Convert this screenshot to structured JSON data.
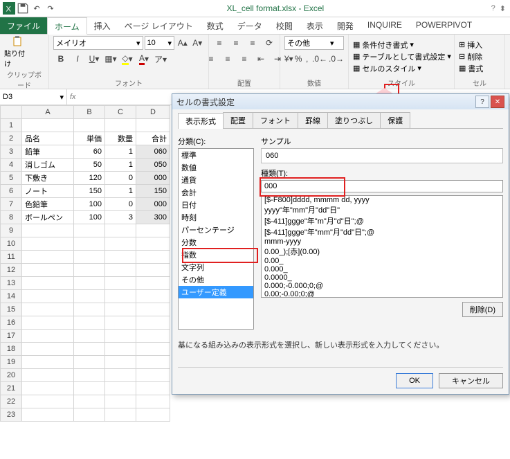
{
  "title": "XL_cell format.xlsx - Excel",
  "tabs": {
    "file": "ファイル",
    "home": "ホーム",
    "insert": "挿入",
    "layout": "ページ レイアウト",
    "formula": "数式",
    "data": "データ",
    "review": "校閲",
    "view": "表示",
    "dev": "開発",
    "inquire": "INQUIRE",
    "pp": "POWERPIVOT"
  },
  "ribbon": {
    "clipboard": {
      "paste": "貼り付け",
      "label": "クリップボード"
    },
    "font": {
      "name": "メイリオ",
      "size": "10",
      "label": "フォント"
    },
    "align": {
      "label": "配置"
    },
    "number": {
      "fmt": "その他",
      "label": "数値"
    },
    "styles": {
      "cond": "条件付き書式",
      "tbl": "テーブルとして書式設定",
      "cell": "セルのスタイル",
      "label": "スタイル"
    },
    "cells": {
      "ins": "挿入",
      "del": "削除",
      "fmt": "書式",
      "label": "セル"
    }
  },
  "namebox": "D3",
  "fx": "fx",
  "sheet": {
    "cols": [
      "A",
      "B",
      "C",
      "D"
    ],
    "headers": {
      "A": "品名",
      "B": "単価",
      "C": "数量",
      "D": "合計"
    },
    "rows": [
      {
        "n": 3,
        "A": "鉛筆",
        "B": "60",
        "C": "1",
        "D": "060"
      },
      {
        "n": 4,
        "A": "消しゴム",
        "B": "50",
        "C": "1",
        "D": "050"
      },
      {
        "n": 5,
        "A": "下敷き",
        "B": "120",
        "C": "0",
        "D": "000"
      },
      {
        "n": 6,
        "A": "ノート",
        "B": "150",
        "C": "1",
        "D": "150"
      },
      {
        "n": 7,
        "A": "色鉛筆",
        "B": "100",
        "C": "0",
        "D": "000"
      },
      {
        "n": 8,
        "A": "ボールペン",
        "B": "100",
        "C": "3",
        "D": "300"
      }
    ]
  },
  "dialog": {
    "title": "セルの書式設定",
    "tabs": {
      "num": "表示形式",
      "align": "配置",
      "font": "フォント",
      "border": "罫線",
      "fill": "塗りつぶし",
      "protect": "保護"
    },
    "catLabel": "分類(C):",
    "cats": [
      "標準",
      "数値",
      "通貨",
      "会計",
      "日付",
      "時刻",
      "パーセンテージ",
      "分数",
      "指数",
      "文字列",
      "その他",
      "ユーザー定義"
    ],
    "sampleLabel": "サンプル",
    "sample": "060",
    "typeLabel": "種類(T):",
    "type": "000",
    "formats": [
      "[$-F800]dddd, mmmm dd, yyyy",
      "yyyy\"年\"mm\"月\"dd\"日\"",
      "[$-411]ggge\"年\"m\"月\"d\"日\";@",
      "[$-411]ggge\"年\"mm\"月\"dd\"日\";@",
      "mmm-yyyy",
      "0.00_);[赤](0.00)",
      "0.00_",
      "0.000_",
      "0.0000_",
      "0.000;-0.000;0;@",
      "0.00;-0.00;0;@"
    ],
    "delete": "削除(D)",
    "hint": "基になる組み込みの表示形式を選択し、新しい表示形式を入力してください。",
    "ok": "OK",
    "cancel": "キャンセル"
  }
}
